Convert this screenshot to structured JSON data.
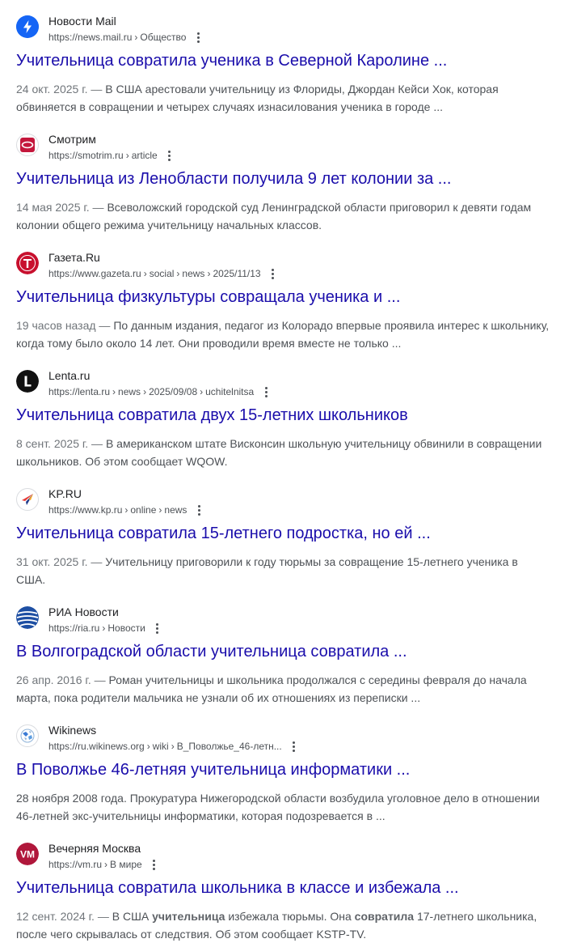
{
  "results": [
    {
      "site_name": "Новости Mail",
      "favicon": "mail-news-lightning-icon",
      "url_base": "https://news.mail.ru",
      "breadcrumbs": [
        "Общество"
      ],
      "title": "Учительница совратила ученика в Северной Каролине ...",
      "date": "24 окт. 2025 г. — ",
      "snippet": "В США арестовали учительницу из Флориды, Джордан Кейси Хок, которая обвиняется в совращении и четырех случаях изнасилования ученика в городе ..."
    },
    {
      "site_name": "Смотрим",
      "favicon": "smotrim-icon",
      "url_base": "https://smotrim.ru",
      "breadcrumbs": [
        "article"
      ],
      "title": "Учительница из Ленобласти получила 9 лет колонии за ...",
      "date": "14 мая 2025 г. — ",
      "snippet": "Всеволожский городской суд Ленинградской области приговорил к девяти годам колонии общего режима учительницу начальных классов."
    },
    {
      "site_name": "Газета.Ru",
      "favicon": "gazeta-t-icon",
      "url_base": "https://www.gazeta.ru",
      "breadcrumbs": [
        "social",
        "news",
        "2025/11/13"
      ],
      "title": "Учительница физкультуры совращала ученика и ...",
      "date": "19 часов назад — ",
      "snippet": "По данным издания, педагог из Колорадо впервые проявила интерес к школьнику, когда тому было около 14 лет. Они проводили время вместе не только ..."
    },
    {
      "site_name": "Lenta.ru",
      "favicon": "lenta-l-icon",
      "url_base": "https://lenta.ru",
      "breadcrumbs": [
        "news",
        "2025/09/08",
        "uchitelnitsa"
      ],
      "title": "Учительница совратила двух 15-летних школьников",
      "date": "8 сент. 2025 г. — ",
      "snippet": "В американском штате Висконсин школьную учительницу обвинили в совращении школьников. Об этом сообщает WQOW."
    },
    {
      "site_name": "KP.RU",
      "favicon": "kp-star-icon",
      "url_base": "https://www.kp.ru",
      "breadcrumbs": [
        "online",
        "news"
      ],
      "title": "Учительница совратила 15-летнего подростка, но ей ...",
      "date": "31 окт. 2025 г. — ",
      "snippet": "Учительницу приговорили к году тюрьмы за совращение 15-летнего ученика в США."
    },
    {
      "site_name": "РИА Новости",
      "favicon": "ria-globe-icon",
      "url_base": "https://ria.ru",
      "breadcrumbs": [
        "Новости"
      ],
      "title": "В Волгоградской области учительница совратила ...",
      "date": "26 апр. 2016 г. — ",
      "snippet": "Роман учительницы и школьника продолжался с середины февраля до начала марта, пока родители мальчика не узнали об их отношениях из переписки ..."
    },
    {
      "site_name": "Wikinews",
      "favicon": "wikinews-globe-icon",
      "url_base": "https://ru.wikinews.org",
      "breadcrumbs": [
        "wiki",
        "В_Поволжье_46-летн..."
      ],
      "title": "В Поволжье 46-летняя учительница информатики ...",
      "date": "",
      "snippet": "28 ноября 2008 года. Прокуратура Нижегородской области возбудила уголовное дело в отношении 46-летней экс-учительницы информатики, которая подозревается в ..."
    },
    {
      "site_name": "Вечерняя Москва",
      "favicon": "vm-logo-icon",
      "url_base": "https://vm.ru",
      "breadcrumbs": [
        "В мире"
      ],
      "title": "Учительница совратила школьника в классе и избежала ...",
      "date": "12 сент. 2024 г. — ",
      "snippet_parts": [
        "В США ",
        "учительница",
        " избежала тюрьмы. Она ",
        "совратила",
        " 17-летнего школьника, после чего скрывалась от следствия. Об этом сообщает KSTP-TV."
      ]
    }
  ],
  "ui": {
    "more_icon": "three-dots-vertical-icon",
    "breadcrumb_separator": "›"
  },
  "colors": {
    "title_link": "#1a0dab",
    "url_text": "#4d5156",
    "snippet_text": "#4d5156",
    "site_name": "#202124"
  }
}
